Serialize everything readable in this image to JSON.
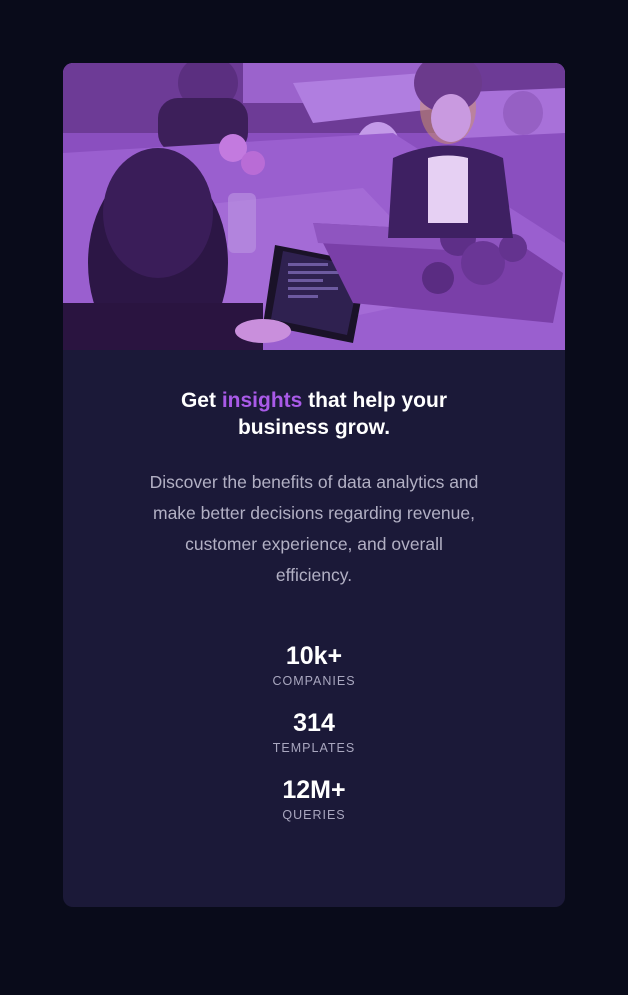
{
  "card": {
    "headline": {
      "before": "Get ",
      "accent": "insights",
      "after": " that help your business grow."
    },
    "description": "Discover the benefits of data analytics and make better decisions regarding revenue, customer experience, and overall efficiency.",
    "stats": [
      {
        "value": "10k+",
        "label": "COMPANIES"
      },
      {
        "value": "314",
        "label": "TEMPLATES"
      },
      {
        "value": "12M+",
        "label": "QUERIES"
      }
    ]
  },
  "colors": {
    "page_background": "#090b1a",
    "card_background": "#1b1938",
    "accent": "#a95ae8",
    "image_tint": "#8a4fbf"
  },
  "hero_image": {
    "icon": "office-workers-photo"
  }
}
